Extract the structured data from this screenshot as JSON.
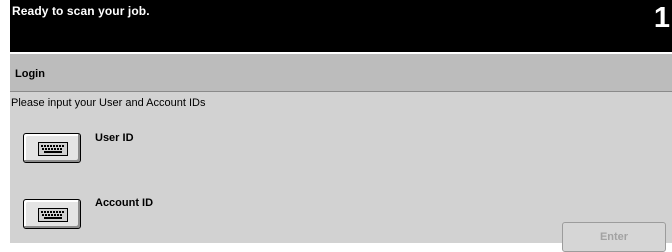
{
  "status": {
    "message": "Ready to scan your job.",
    "quantity": "1"
  },
  "screen": {
    "title": "Login",
    "instruction": "Please input your User and Account IDs"
  },
  "fields": {
    "user_id_label": "User ID",
    "account_id_label": "Account ID"
  },
  "actions": {
    "enter_label": "Enter"
  },
  "icons": {
    "keyboard": "keyboard-icon"
  }
}
